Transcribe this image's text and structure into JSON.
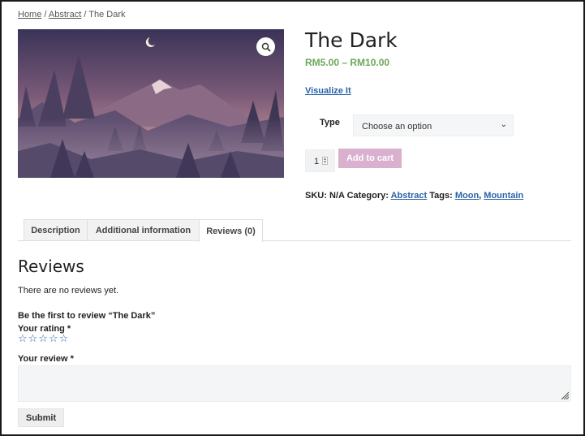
{
  "breadcrumb": {
    "home": "Home",
    "separator": " / ",
    "category": "Abstract",
    "current": "The Dark"
  },
  "product": {
    "title": "The Dark",
    "price": "RM5.00 – RM10.00",
    "visualize_link": "Visualize It",
    "zoom_icon": "magnifier-icon",
    "type_label": "Type",
    "type_selected": "Choose an option",
    "quantity": "1",
    "add_to_cart": "Add to cart",
    "meta": {
      "sku_label": "SKU:",
      "sku_value": "N/A",
      "category_label": "Category:",
      "category_value": "Abstract",
      "tags_label": "Tags:",
      "tags": [
        "Moon",
        "Mountain"
      ],
      "tag_separator": ", "
    }
  },
  "tabs": [
    {
      "label": "Description",
      "active": false
    },
    {
      "label": "Additional information",
      "active": false
    },
    {
      "label": "Reviews (0)",
      "active": true
    }
  ],
  "reviews": {
    "heading": "Reviews",
    "empty_text": "There are no reviews yet.",
    "first_review_text": "Be the first to review “The Dark”",
    "rating_label": "Your rating *",
    "stars_count": 5,
    "review_label": "Your review *",
    "submit": "Submit"
  },
  "colors": {
    "price": "#6aa85a",
    "link": "#2b63a8",
    "add_to_cart_bg": "#d9b1cf"
  }
}
